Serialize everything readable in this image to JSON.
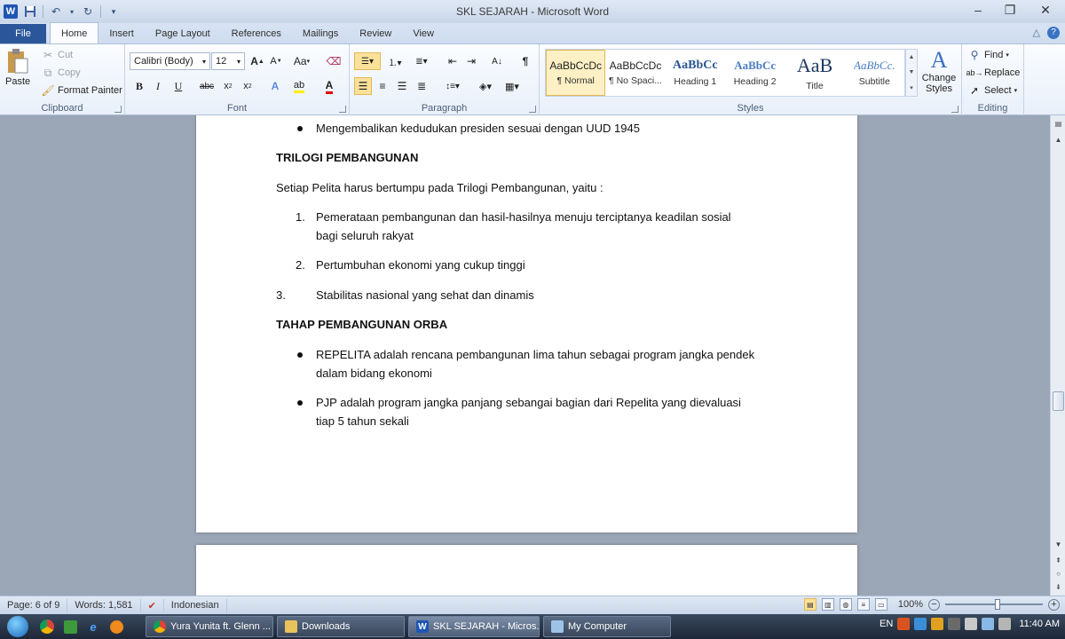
{
  "app": {
    "window_title": "SKL SEJARAH  -  Microsoft Word",
    "logo_letter": "W"
  },
  "qat": {
    "save_icon": "save-icon",
    "undo_icon": "undo-icon",
    "redo_icon": "redo-icon",
    "customize_icon": "customize-qat-icon"
  },
  "tabs": {
    "file": "File",
    "items": [
      "Home",
      "Insert",
      "Page Layout",
      "References",
      "Mailings",
      "Review",
      "View"
    ],
    "active": "Home"
  },
  "ribbon": {
    "clipboard": {
      "label": "Clipboard",
      "paste": "Paste",
      "cut": "Cut",
      "copy": "Copy",
      "format_painter": "Format Painter"
    },
    "font": {
      "label": "Font",
      "font_name": "Calibri (Body)",
      "font_size": "12",
      "change_case": "Aa"
    },
    "paragraph": {
      "label": "Paragraph"
    },
    "styles": {
      "label": "Styles",
      "items": [
        {
          "preview": "AaBbCcDc",
          "name": "¶ Normal"
        },
        {
          "preview": "AaBbCcDc",
          "name": "¶ No Spaci..."
        },
        {
          "preview": "AaBbCc",
          "name": "Heading 1"
        },
        {
          "preview": "AaBbCc",
          "name": "Heading 2"
        },
        {
          "preview": "AaB",
          "name": "Title"
        },
        {
          "preview": "AaBbCc.",
          "name": "Subtitle"
        }
      ],
      "change_styles": "Change Styles"
    },
    "editing": {
      "label": "Editing",
      "find": "Find",
      "replace": "Replace",
      "select": "Select"
    }
  },
  "document": {
    "page1_bullet_top": "Mengembalikan kedudukan  presiden sesuai dengan UUD 1945",
    "heading1": "TRILOGI PEMBANGUNAN",
    "para1": "Setiap Pelita harus bertumpu pada Trilogi Pembangunan, yaitu :",
    "list": [
      {
        "num": "1.",
        "line1": "Pemerataan pembangunan dan hasil-hasilnya menuju terciptanya keadilan sosial",
        "line2": "bagi seluruh rakyat"
      },
      {
        "num": "2.",
        "line1": "Pertumbuhan ekonomi yang cukup tinggi",
        "line2": ""
      },
      {
        "num": "3.",
        "line1": "Stabilitas nasional yang sehat dan dinamis",
        "line2": ""
      }
    ],
    "heading2": "TAHAP PEMBANGUNAN ORBA",
    "bullets2": [
      {
        "line1": "REPELITA adalah rencana pembangunan lima tahun sebagai program jangka pendek",
        "line2": "dalam bidang ekonomi"
      },
      {
        "line1": "PJP adalah  program jangka panjang sebangai bagian dari Repelita yang dievaluasi",
        "line2": "tiap 5 tahun sekali"
      }
    ]
  },
  "status": {
    "page": "Page: 6 of 9",
    "words": "Words: 1,581",
    "language": "Indonesian",
    "zoom": "100%"
  },
  "taskbar": {
    "tasks": [
      {
        "label": "Yura Yunita ft. Glenn ...",
        "icon": "chrome-icon"
      },
      {
        "label": "Downloads",
        "icon": "folder-icon"
      },
      {
        "label": "SKL SEJARAH - Micros...",
        "icon": "word-icon"
      },
      {
        "label": "My Computer",
        "icon": "computer-icon"
      }
    ],
    "lang": "EN",
    "time": "11:40 AM"
  },
  "colors": {
    "accent": "#2b579a",
    "ribbon_bg": "#e9f0fa",
    "selected_style": "#fdf0c4"
  }
}
